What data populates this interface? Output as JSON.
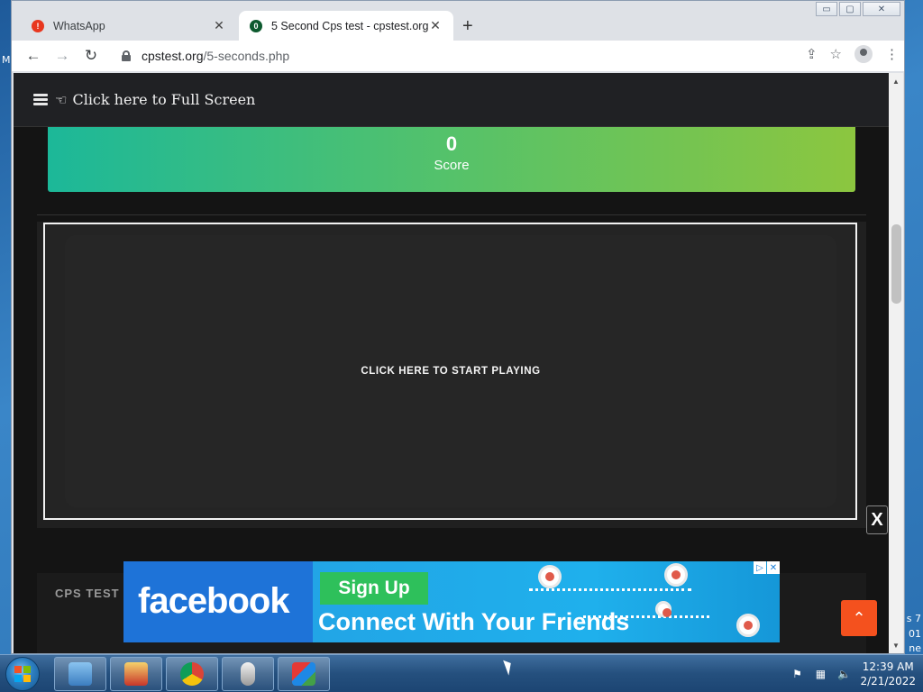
{
  "desktop": {
    "edge_texts": [
      "M",
      "s 7",
      "01",
      "ne"
    ]
  },
  "browser": {
    "tabs": [
      {
        "title": "WhatsApp",
        "icon": "whatsapp-icon",
        "active": false
      },
      {
        "title": "5 Second Cps test - cpstest.org",
        "icon": "cpstest-icon",
        "active": true
      }
    ],
    "new_tab_glyph": "+",
    "url_host": "cpstest.org",
    "url_path": "/5-seconds.php",
    "window_controls": {
      "minimize": "▭",
      "maximize": "▢",
      "close": "✕"
    }
  },
  "site": {
    "header": {
      "fullscreen_label": "Click here to Full Screen"
    },
    "score": {
      "value": "0",
      "label": "Score"
    },
    "play_area": {
      "label": "CLICK HERE TO START PLAYING"
    },
    "close_button": "X",
    "section_title": "CPS TEST",
    "scroll_top_glyph": "⌃"
  },
  "ad": {
    "brand": "facebook",
    "cta": "Sign Up",
    "tagline": "Connect With Your Friends",
    "colors": {
      "brand_blue": "#1877f2",
      "cta_green": "#2ec05b"
    }
  },
  "taskbar": {
    "clock_time": "12:39 AM",
    "clock_date": "2/21/2022",
    "apps": [
      "computer-icon",
      "solitaire-icon",
      "chrome-icon",
      "mouse-icon",
      "paint-icon"
    ]
  },
  "colors": {
    "accent_orange": "#f4511e",
    "score_gradient_start": "#1cb899",
    "score_gradient_end": "#8cc63f"
  }
}
